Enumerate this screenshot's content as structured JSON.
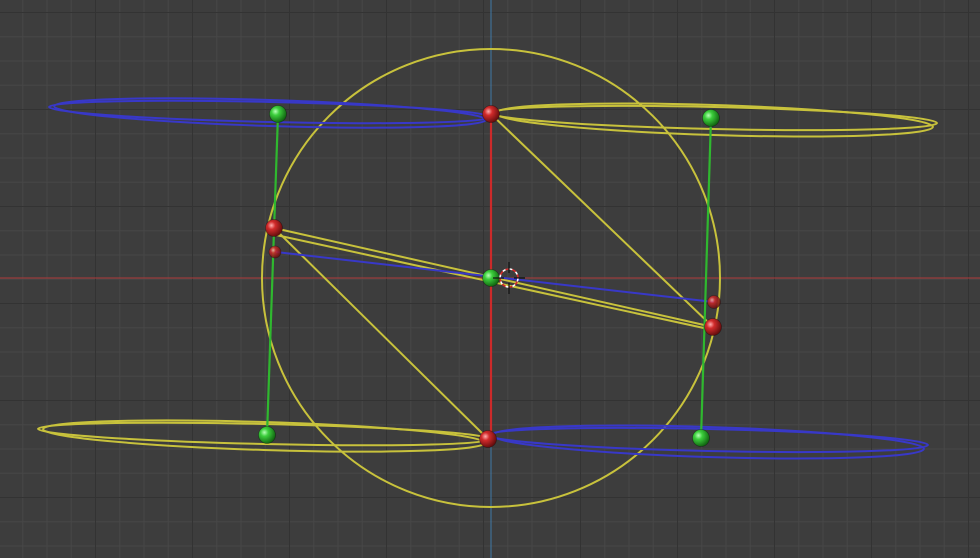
{
  "viewport": {
    "background": "#3d3d3d",
    "axis_x_color": "#b03a3a",
    "axis_y_color": "#3f79a8"
  },
  "colors": {
    "yellow_wire": "#c8c23c",
    "blue_wire": "#3838c8",
    "green_wire": "#2fb82f",
    "red_wire": "#cc2a2a",
    "green_vertex": "#3ccf3c",
    "red_vertex": "#d22b2b"
  },
  "icons": {
    "cursor": "3d-cursor-icon"
  }
}
